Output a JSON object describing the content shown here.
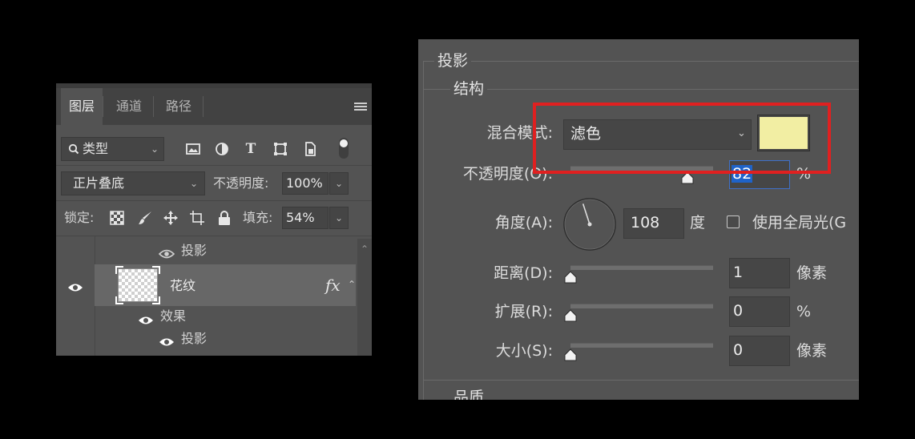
{
  "layers_panel": {
    "tabs": [
      {
        "label": "图层",
        "active": true
      },
      {
        "label": "通道",
        "active": false
      },
      {
        "label": "路径",
        "active": false
      }
    ],
    "filter": {
      "icon": "search-icon",
      "label": "类型"
    },
    "filter_icons": [
      "image-filter-icon",
      "adjustment-filter-icon",
      "type-filter-icon",
      "shape-filter-icon",
      "smart-object-filter-icon",
      "filter-toggle-icon"
    ],
    "blend_mode": "正片叠底",
    "opacity_label": "不透明度:",
    "opacity_value": "100%",
    "lock_label": "锁定:",
    "lock_icons": [
      "lock-transparent-icon",
      "lock-image-icon",
      "lock-position-icon",
      "lock-artboard-icon",
      "lock-all-icon"
    ],
    "fill_label": "填充:",
    "fill_value": "54%",
    "rows": {
      "prev_effect": "投影",
      "layer_name": "花纹",
      "fx": "fx",
      "effects_label": "效果",
      "effect_item": "投影"
    }
  },
  "style_dialog": {
    "title": "投影",
    "section": "结构",
    "blend_label": "混合模式:",
    "blend_value": "滤色",
    "shadow_color": "#f2eea3",
    "opacity_label": "不透明度(O):",
    "opacity_value": "82",
    "opacity_unit": "%",
    "opacity_level": 82,
    "angle_label": "角度(A):",
    "angle_value": "108",
    "angle_unit": "度",
    "global_light_label": "使用全局光(G",
    "distance_label": "距离(D):",
    "distance_value": "1",
    "distance_unit": "像素",
    "spread_label": "扩展(R):",
    "spread_value": "0",
    "spread_unit": "%",
    "size_label": "大小(S):",
    "size_value": "0",
    "size_unit": "像素",
    "next_section": "品质"
  },
  "colors": {
    "panel_bg": "#535353",
    "selected_row": "#676767",
    "highlight": "#e02020",
    "text_selection": "#1f63c9"
  }
}
